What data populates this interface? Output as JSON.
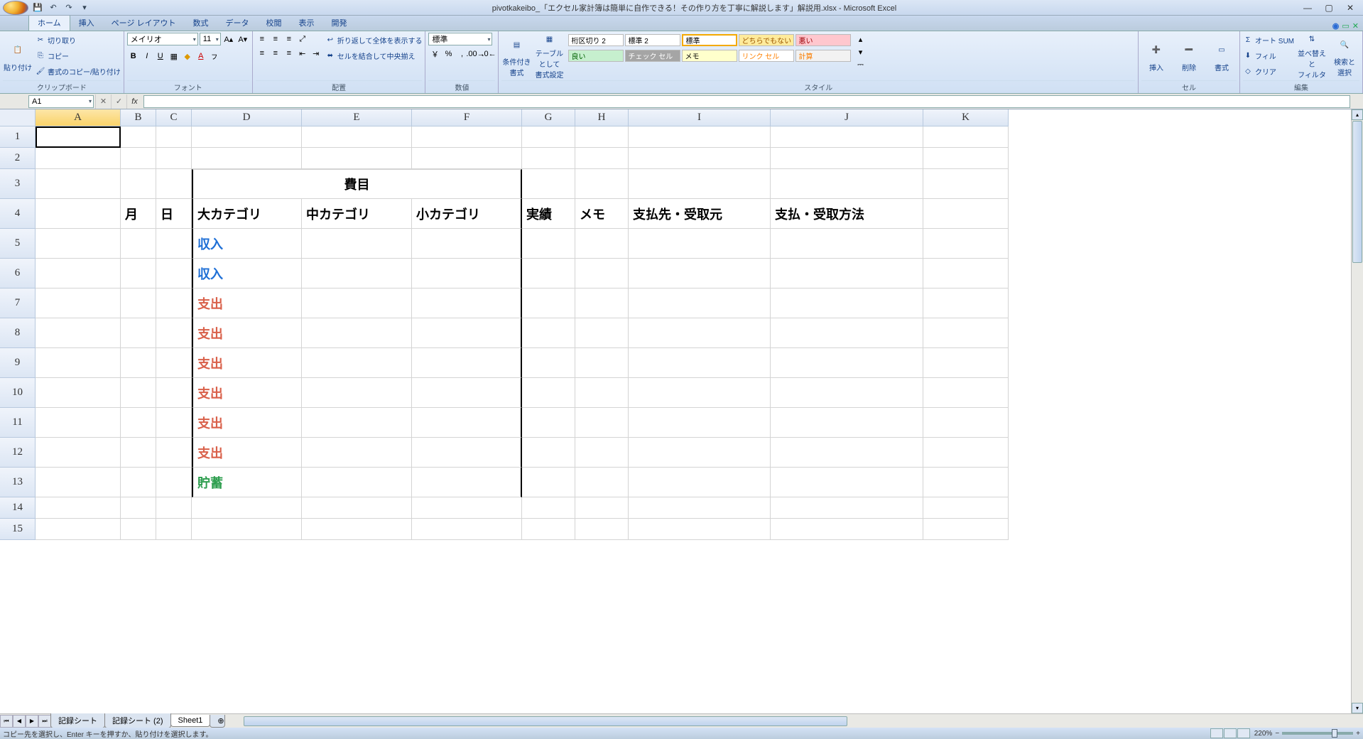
{
  "title": "pivotkakeibo_「エクセル家計簿は簡単に自作できる！その作り方を丁寧に解説します」解説用.xlsx - Microsoft Excel",
  "tabs": [
    "ホーム",
    "挿入",
    "ページ レイアウト",
    "数式",
    "データ",
    "校閲",
    "表示",
    "開発"
  ],
  "active_tab": 0,
  "clipboard": {
    "paste": "貼り付け",
    "cut": "切り取り",
    "copy": "コピー",
    "format": "書式のコピー/貼り付け",
    "label": "クリップボード"
  },
  "font": {
    "name": "メイリオ",
    "size": "11",
    "label": "フォント"
  },
  "align": {
    "wrap": "折り返して全体を表示する",
    "merge": "セルを結合して中央揃え",
    "label": "配置"
  },
  "number": {
    "format": "標準",
    "label": "数値"
  },
  "styles": {
    "cond": "条件付き\n書式",
    "table": "テーブルとして\n書式設定",
    "chips": {
      "comma": "桁区切り 2",
      "std2": "標準 2",
      "standard": "標準",
      "neutral": "どちらでもない",
      "bad": "悪い",
      "good": "良い",
      "check": "チェック セル",
      "memo": "メモ",
      "link": "リンク セル",
      "calc": "計算"
    },
    "label": "スタイル"
  },
  "cells": {
    "insert": "挿入",
    "delete": "削除",
    "format": "書式",
    "label": "セル"
  },
  "editing": {
    "sum": "オート SUM",
    "fill": "フィル",
    "clear": "クリア",
    "sort": "並べ替えと\nフィルタ",
    "find": "検索と\n選択",
    "label": "編集"
  },
  "name_box": "A1",
  "columns": [
    "A",
    "B",
    "C",
    "D",
    "E",
    "F",
    "G",
    "H",
    "I",
    "J",
    "K"
  ],
  "rows": [
    "1",
    "2",
    "3",
    "4",
    "5",
    "6",
    "7",
    "8",
    "9",
    "10",
    "11",
    "12",
    "13",
    "14",
    "15"
  ],
  "data": {
    "merged_r3": "費目",
    "r4": {
      "B": "月",
      "C": "日",
      "D": "大カテゴリ",
      "E": "中カテゴリ",
      "F": "小カテゴリ",
      "G": "実績",
      "H": "メモ",
      "I": "支払先・受取元",
      "J": "支払・受取方法"
    },
    "r5D": "収入",
    "r6D": "収入",
    "r7D": "支出",
    "r8D": "支出",
    "r9D": "支出",
    "r10D": "支出",
    "r11D": "支出",
    "r12D": "支出",
    "r13D": "貯蓄"
  },
  "sheets": {
    "s1": "記録シート",
    "s2": "記録シート (2)",
    "s3": "Sheet1"
  },
  "status_msg": "コピー先を選択し、Enter キーを押すか、貼り付けを選択します。",
  "zoom": "220%"
}
